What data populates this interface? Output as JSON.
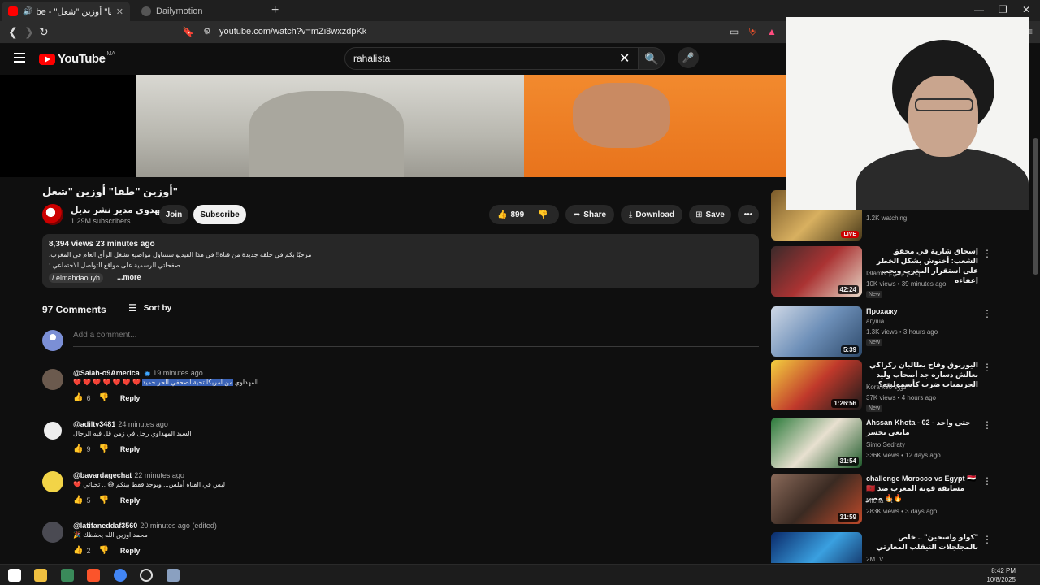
{
  "browser": {
    "tabs": [
      {
        "title": "be - \"أوزين \"طفا\" أوزين \"شعل",
        "active": true
      },
      {
        "title": "Dailymotion",
        "active": false
      }
    ],
    "url": "youtube.com/watch?v=mZi8wxzdpKk",
    "new_tab": "+",
    "close_glyph": "✕"
  },
  "header": {
    "logo": "YouTube",
    "country": "MA",
    "search_value": "rahalista"
  },
  "video": {
    "title": "\"أوزين \"طفا\" أوزين \"شعل",
    "channel": "المهدوي مدير نشر بديل",
    "subscribers": "1.29M subscribers",
    "join": "Join",
    "subscribe": "Subscribe",
    "likes": "899",
    "share": "Share",
    "download": "Download",
    "save": "Save",
    "more": "•••"
  },
  "description": {
    "stats": "8,394 views  23 minutes ago",
    "line1": "مرحبًا بكم في حلقة جديدة من قناة!! في هذا الفيديو سنتناول مواضيع تشغل الرأي العام في المغرب.",
    "line2": "صفحاتي الرسمية على مواقع التواصل الاجتماعي :",
    "handle": "/ elmahdaouyh",
    "more": "...more"
  },
  "comments": {
    "count": "97 Comments",
    "sort": "Sort by",
    "add_placeholder": "Add a comment...",
    "items": [
      {
        "author": "@Salah-o9America",
        "time": "19 minutes ago",
        "text_pre": "❤️ ❤️ ❤️ ❤️ ❤️ ❤️ ❤️ المهداوي ",
        "text_hl": "من امريكا تحية لصحفي الحر حميد",
        "likes": "6",
        "reply": "Reply"
      },
      {
        "author": "@adiltv3481",
        "time": "24 minutes ago",
        "text_pre": "السيد المهداوي رجل في زمن قل فيه الرجال",
        "text_hl": "",
        "likes": "9",
        "reply": "Reply"
      },
      {
        "author": "@bavardagechat",
        "time": "22 minutes ago",
        "text_pre": "❤️ ليس في القناة أملس... ويوجد فقط بينكم 😅 .. تحياتي",
        "text_hl": "",
        "likes": "5",
        "reply": "Reply"
      },
      {
        "author": "@latifaneddaf3560",
        "time": "20 minutes ago (edited)",
        "text_pre": "🎉 محمد اوزين الله يحفظك",
        "text_hl": "",
        "likes": "2",
        "reply": "Reply"
      }
    ]
  },
  "sidebar": {
    "items": [
      {
        "title": "",
        "channel": "",
        "meta": "1.2K watching",
        "badge": "",
        "duration": "",
        "live": "LIVE"
      },
      {
        "title": "إسحاق شارية في محقق الشعب: أخنوش يشكل الخطر على استقرار المغرب ويجب إعفاءه",
        "channel": "I3lamtv | إعلام تيفي",
        "meta": "10K views • 39 minutes ago",
        "badge": "New",
        "duration": "42:24",
        "live": ""
      },
      {
        "title": "Прохажу",
        "channel": "агуша",
        "meta": "1.3K views • 3 hours ago",
        "badge": "New",
        "duration": "5:39",
        "live": ""
      },
      {
        "title": "اليوزنوق وفاح بطالبان ركراكي بعالش دساره جد أصحاب وليد الحريميات ضرب كأسموليته؟",
        "channel": "Kora x90 كورة",
        "meta": "37K views • 4 hours ago",
        "badge": "New",
        "duration": "1:26:56",
        "live": ""
      },
      {
        "title": "Ahssan Khota - 02 - حتى واحد مابغى يخسر",
        "channel": "Simo Sedraty",
        "meta": "336K views • 12 days ago",
        "badge": "",
        "duration": "31:54",
        "live": ""
      },
      {
        "title": "challenge Morocco vs Egypt 🇪🇬 🇲🇦 مسابقة قوية المغرب ضد مصر 🔥🔥",
        "channel": "Micha Fit",
        "meta": "283K views • 3 days ago",
        "badge": "",
        "duration": "31:59",
        "live": ""
      },
      {
        "title": "\"كولو واسحين\" .. خاص بالمجلجلات التيقلب المعارتي",
        "channel": "2MTV",
        "meta": "",
        "badge": "",
        "duration": "",
        "live": ""
      }
    ]
  },
  "taskbar": {
    "time": "8:42 PM",
    "date": "10/8/2025"
  },
  "colors": {
    "background": "#0f0f0f",
    "youtube_red": "#ff0000",
    "highlight": "#3a63b8"
  }
}
